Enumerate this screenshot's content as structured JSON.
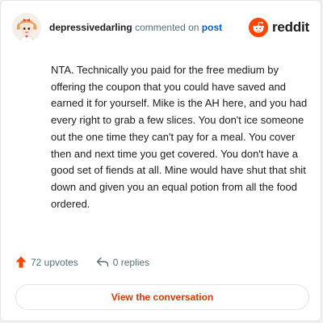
{
  "header": {
    "username": "depressivedarling",
    "action_text": "commented on",
    "post_link": "post",
    "brand": "reddit"
  },
  "comment": {
    "body": "NTA. Technically you paid for the free medium by offering the coupon that you could have saved and earned it for yourself. Mike is the AH here, and you had every right to grab a few slices. You don't ice someone out the one time they can't pay for a meal. You cover then and next time you get covered. You don't have a good set of fiends at all. Mine would have shut that shit down and given you an equal potion from all the food ordered."
  },
  "stats": {
    "upvotes": "72 upvotes",
    "replies": "0 replies"
  },
  "cta": {
    "label": "View the conversation"
  },
  "icons": {
    "avatar": "avatar-icon",
    "logo": "reddit-logo-icon",
    "upvote": "upvote-arrow-icon",
    "reply": "reply-arrow-icon"
  },
  "colors": {
    "brand_orange": "#ff4500",
    "upvote": "#ff4500",
    "cta_text": "#d93a00",
    "link_blue": "#0a5cc8"
  }
}
